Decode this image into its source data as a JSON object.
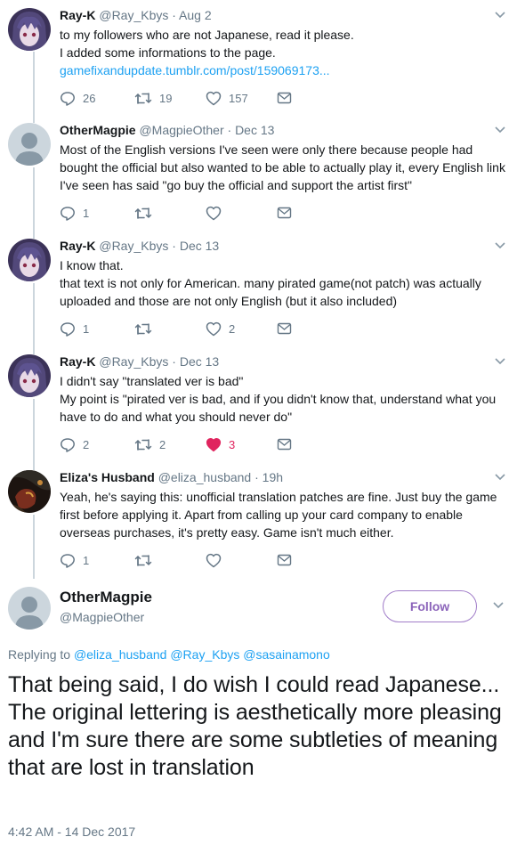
{
  "colors": {
    "accent": "#1da1f2",
    "muted": "#657786",
    "like": "#e0245e",
    "follow": "#8b63ba",
    "thread_line": "#ccd6dd"
  },
  "replies": [
    {
      "name": "Ray-K",
      "handle": "@Ray_Kbys",
      "date": " · Aug 2",
      "avatar": "anime-avatar",
      "lines": [
        "to my followers who are not Japanese, read it please.",
        "I added some informations to the page."
      ],
      "link": "gamefixandupdate.tumblr.com/post/159069173...",
      "reply_count": "26",
      "retweet_count": "19",
      "like_count": "157",
      "liked": false
    },
    {
      "name": "OtherMagpie",
      "handle": "@MagpieOther",
      "date": " · Dec 13",
      "avatar": "default-avatar",
      "lines": [
        "Most of the English versions I've seen were only there because people had",
        "bought the official but also wanted to be able to actually play it, every English link",
        "I've seen has said \"go buy the official and support the artist first\""
      ],
      "reply_count": "1",
      "retweet_count": "",
      "like_count": "",
      "liked": false
    },
    {
      "name": "Ray-K",
      "handle": "@Ray_Kbys",
      "date": " · Dec 13",
      "avatar": "anime-avatar",
      "lines": [
        "I know that.",
        "that text is not only for American. many pirated game(not patch) was actually",
        "uploaded and those are not only English (but it also included)"
      ],
      "reply_count": "1",
      "retweet_count": "",
      "like_count": "2",
      "liked": false
    },
    {
      "name": "Ray-K",
      "handle": "@Ray_Kbys",
      "date": " · Dec 13",
      "avatar": "anime-avatar",
      "lines": [
        "I didn't say \"translated ver is bad\"",
        "My point is \"pirated ver is bad, and if you didn't know that, understand what you",
        "have to do and what you should never do\""
      ],
      "reply_count": "2",
      "retweet_count": "2",
      "like_count": "3",
      "liked": true
    },
    {
      "name": "Eliza's Husband",
      "handle": "@eliza_husband",
      "date": " · 19h",
      "avatar": "dark-avatar",
      "lines": [
        "Yeah, he's saying this: unofficial translation patches are fine. Just buy the game",
        "first before applying it. Apart from calling up your card company to enable",
        "overseas purchases, it's pretty easy. Game isn't much either."
      ],
      "reply_count": "1",
      "retweet_count": "",
      "like_count": "",
      "liked": false
    }
  ],
  "main": {
    "name": "OtherMagpie",
    "handle": "@MagpieOther",
    "follow_label": "Follow",
    "replying_prefix": "Replying to",
    "mentions": [
      "@eliza_husband",
      "@Ray_Kbys",
      "@sasainamono"
    ],
    "text": "That being said, I do wish I could read Japanese... The original lettering is aesthetically more pleasing and I'm sure there are some subtleties of meaning that are lost in translation",
    "timestamp": "4:42 AM - 14 Dec 2017"
  }
}
